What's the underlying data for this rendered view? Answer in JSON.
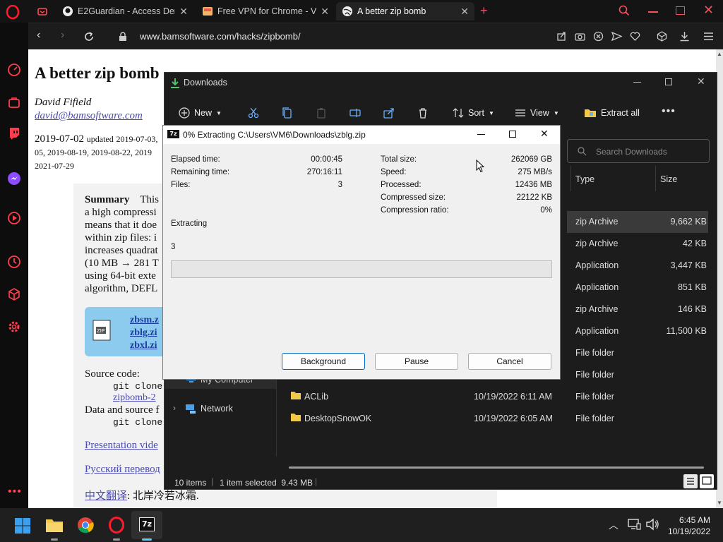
{
  "browser": {
    "tabs": [
      {
        "title": "E2Guardian - Access Denie"
      },
      {
        "title": "Free VPN for Chrome - VPN"
      },
      {
        "title": "A better zip bomb"
      }
    ],
    "url": "www.bamsoftware.com/hacks/zipbomb/"
  },
  "page": {
    "title": "A better zip bomb",
    "author": "David Fifield",
    "email": "david@bamsoftware.com",
    "date": "2019-07-02",
    "updated_label": "updated",
    "updated_1": "2019-07-03,",
    "updated_2": "05, 2019-08-19, 2019-08-22, 2019",
    "updated_3": "2021-07-29",
    "summary_head": "Summary",
    "summary_lines": [
      "This",
      "a high compressi",
      "means that it doe",
      "within zip files: i",
      "increases quadrat",
      "(10 MB → 281 T",
      "using 64-bit exte",
      "algorithm, DEFL"
    ],
    "files": [
      "zbsm.z",
      "zblg.zi",
      "zbxl.zi"
    ],
    "source_code": "Source code:",
    "git_clone_1": "git clone",
    "zipbomb_link": "zipbomb-2",
    "data_source": "Data and source f",
    "git_clone_2": "git clone",
    "presentation": "Presentation vide",
    "russian": "Русский перевод",
    "chinese_link": "中文翻译",
    "chinese_rest": ": 北岸冷若冰霜."
  },
  "explorer": {
    "title": "Downloads",
    "toolbar": {
      "new": "New",
      "sort": "Sort",
      "view": "View",
      "extract_all": "Extract all"
    },
    "search_placeholder": "Search Downloads",
    "columns": {
      "type": "Type",
      "size": "Size"
    },
    "rows": [
      {
        "type": "zip Archive",
        "size": "9,662 KB"
      },
      {
        "type": "zip Archive",
        "size": "42 KB"
      },
      {
        "type": "Application",
        "size": "3,447 KB"
      },
      {
        "type": "Application",
        "size": "851 KB"
      },
      {
        "type": "zip Archive",
        "size": "146 KB"
      },
      {
        "type": "Application",
        "size": "11,500 KB"
      },
      {
        "type": "File folder",
        "size": ""
      },
      {
        "type": "File folder",
        "size": ""
      },
      {
        "name": "ACLib",
        "date": "10/19/2022 6:11 AM",
        "type": "File folder",
        "size": ""
      },
      {
        "name": "DesktopSnowOK",
        "date": "10/19/2022 6:05 AM",
        "type": "File folder",
        "size": ""
      }
    ],
    "nav": {
      "my_computer": "My Computer",
      "network": "Network"
    },
    "status": {
      "items": "10 items",
      "selected": "1 item selected  9.43 MB"
    }
  },
  "dialog": {
    "title": "0% Extracting C:\\Users\\VM6\\Downloads\\zblg.zip",
    "elapsed_label": "Elapsed time:",
    "elapsed": "00:00:45",
    "remaining_label": "Remaining time:",
    "remaining": "270:16:11",
    "files_label": "Files:",
    "files": "3",
    "total_label": "Total size:",
    "total": "262069 GB",
    "speed_label": "Speed:",
    "speed": "275 MB/s",
    "processed_label": "Processed:",
    "processed": "12436 MB",
    "compressed_label": "Compressed size:",
    "compressed": "22122 KB",
    "ratio_label": "Compression ratio:",
    "ratio": "0%",
    "status": "Extracting",
    "current": "3",
    "progress": 0,
    "buttons": {
      "background": "Background",
      "pause": "Pause",
      "cancel": "Cancel"
    }
  },
  "taskbar": {
    "time": "6:45 AM",
    "date": "10/19/2022"
  },
  "colors": {
    "accent": "#0067c0",
    "opera_red": "#ff1b2d"
  }
}
